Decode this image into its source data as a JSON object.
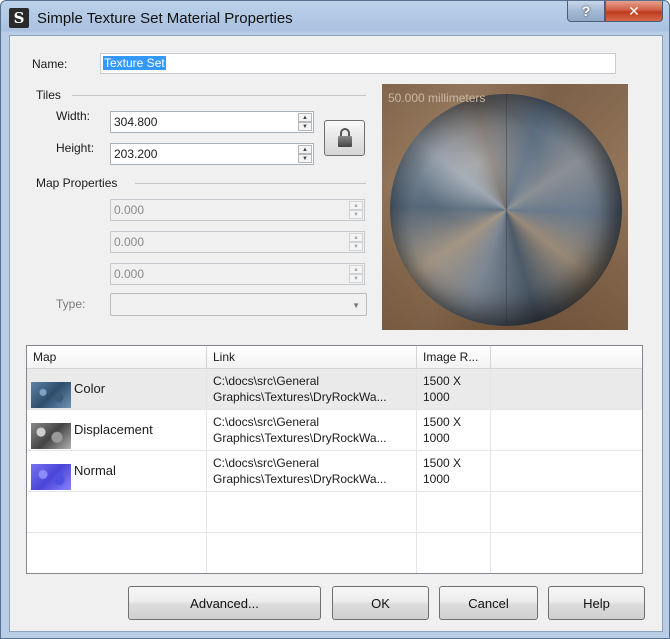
{
  "window": {
    "title": "Simple Texture Set Material Properties",
    "help_label": "?",
    "close_label": "✕",
    "app_icon": "S"
  },
  "name": {
    "label": "Name:",
    "value": "Texture Set"
  },
  "tiles": {
    "group_label": "Tiles",
    "width_label": "Width:",
    "width_value": "304.800",
    "height_label": "Height:",
    "height_value": "203.200",
    "lock_icon": "lock-icon"
  },
  "map_properties": {
    "group_label": "Map Properties",
    "fields": [
      "0.000",
      "0.000",
      "0.000"
    ],
    "type_label": "Type:",
    "type_value": ""
  },
  "preview": {
    "caption": "50.000 millimeters"
  },
  "maps_table": {
    "columns": [
      "Map",
      "Link",
      "Image R..."
    ],
    "rows": [
      {
        "map": "Color",
        "link_line1": "C:\\docs\\src\\General",
        "link_line2": "Graphics\\Textures\\DryRockWa...",
        "res_line1": "1500 X",
        "res_line2": "1000",
        "thumb": "color"
      },
      {
        "map": "Displacement",
        "link_line1": "C:\\docs\\src\\General",
        "link_line2": "Graphics\\Textures\\DryRockWa...",
        "res_line1": "1500 X",
        "res_line2": "1000",
        "thumb": "displacement"
      },
      {
        "map": "Normal",
        "link_line1": "C:\\docs\\src\\General",
        "link_line2": "Graphics\\Textures\\DryRockWa...",
        "res_line1": "1500 X",
        "res_line2": "1000",
        "thumb": "normal"
      }
    ]
  },
  "buttons": {
    "advanced": "Advanced...",
    "ok": "OK",
    "cancel": "Cancel",
    "help": "Help"
  },
  "colors": {
    "selection": "#3399ff",
    "title_bar": "#b9cde6",
    "close_button": "#c0391c"
  }
}
